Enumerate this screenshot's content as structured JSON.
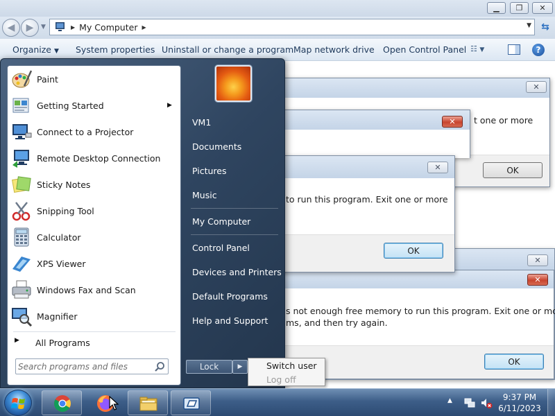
{
  "explorer": {
    "address": "My Computer",
    "toolbar": {
      "organize": "Organize",
      "system_properties": "System properties",
      "uninstall": "Uninstall or change a program",
      "map_drive": "Map network drive",
      "control_panel": "Open Control Panel"
    }
  },
  "dialogs": {
    "back": {
      "line1": "t one or more",
      "ok": "OK"
    },
    "middle": {
      "line1": "to run this program. Exit one or more",
      "ok": "OK"
    },
    "front": {
      "line1": "s not enough free memory to run this program. Exit one or more",
      "line2": "ms, and then try again.",
      "ok": "OK"
    },
    "close_symbol": "✕"
  },
  "start_menu": {
    "programs": [
      {
        "label": "Paint",
        "icon": "paint-icon",
        "has_submenu": false
      },
      {
        "label": "Getting Started",
        "icon": "getting-started-icon",
        "has_submenu": true
      },
      {
        "label": "Connect to a Projector",
        "icon": "projector-icon",
        "has_submenu": false
      },
      {
        "label": "Remote Desktop Connection",
        "icon": "remote-desktop-icon",
        "has_submenu": false
      },
      {
        "label": "Sticky Notes",
        "icon": "sticky-notes-icon",
        "has_submenu": false
      },
      {
        "label": "Snipping Tool",
        "icon": "snipping-tool-icon",
        "has_submenu": false
      },
      {
        "label": "Calculator",
        "icon": "calculator-icon",
        "has_submenu": false
      },
      {
        "label": "XPS Viewer",
        "icon": "xps-viewer-icon",
        "has_submenu": false
      },
      {
        "label": "Windows Fax and Scan",
        "icon": "fax-scan-icon",
        "has_submenu": false
      },
      {
        "label": "Magnifier",
        "icon": "magnifier-icon",
        "has_submenu": false
      }
    ],
    "all_programs": "All Programs",
    "search_placeholder": "Search programs and files",
    "right_items": {
      "user": "VM1",
      "documents": "Documents",
      "pictures": "Pictures",
      "music": "Music",
      "computer": "My Computer",
      "control_panel": "Control Panel",
      "devices": "Devices and Printers",
      "default_programs": "Default Programs",
      "help": "Help and Support"
    },
    "lock_label": "Lock",
    "shutdown_menu": {
      "switch_user": "Switch user",
      "log_off": "Log off"
    }
  },
  "taskbar": {
    "pinned": [
      "chrome-icon",
      "firefox-icon",
      "explorer-folder-icon",
      "remote-app-icon"
    ],
    "time": "9:37 PM",
    "date": "6/11/2023"
  }
}
